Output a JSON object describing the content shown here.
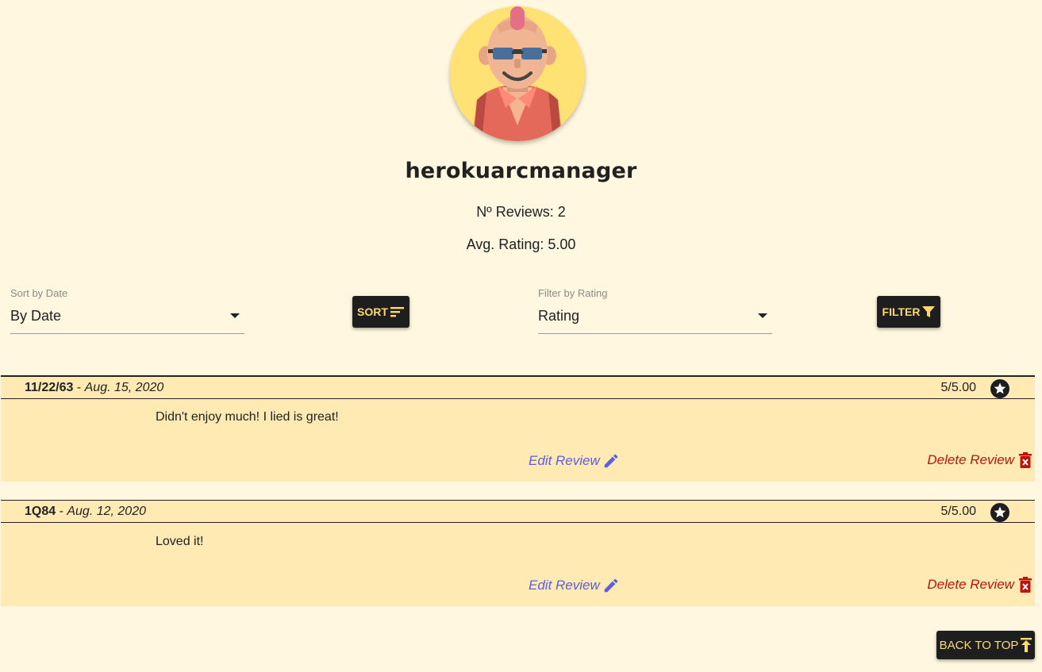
{
  "profile": {
    "username": "herokuarcmanager",
    "reviews_count": "Nº Reviews: 2",
    "avg_rating": "Avg. Rating: 5.00"
  },
  "controls": {
    "sort_label": "Sort by Date",
    "sort_value": "By Date",
    "sort_button": "SORT",
    "filter_label": "Filter by Rating",
    "filter_value": "Rating",
    "filter_button": "FILTER"
  },
  "reviews": [
    {
      "book": "11/22/63",
      "sep": " - ",
      "date": "Aug. 15, 2020",
      "score": "5/5.00",
      "text": "Didn't enjoy much! I lied is great!",
      "edit": "Edit Review",
      "delete": "Delete Review"
    },
    {
      "book": "1Q84",
      "sep": " - ",
      "date": "Aug. 12, 2020",
      "score": "5/5.00",
      "text": "Loved it!",
      "edit": "Edit Review",
      "delete": "Delete Review"
    }
  ],
  "footer": {
    "back_to_top": "BACK TO TOP"
  },
  "colors": {
    "background": "#fff7df",
    "card": "#ffeab3",
    "button": "#1e1e1e",
    "button_text": "#ffd970",
    "edit": "#5b5fe0",
    "delete": "#c0110f"
  },
  "icons": [
    "avatar-illustration",
    "sort-icon",
    "filter-icon",
    "star-icon",
    "pencil-icon",
    "trash-icon",
    "arrow-up-bar-icon"
  ]
}
